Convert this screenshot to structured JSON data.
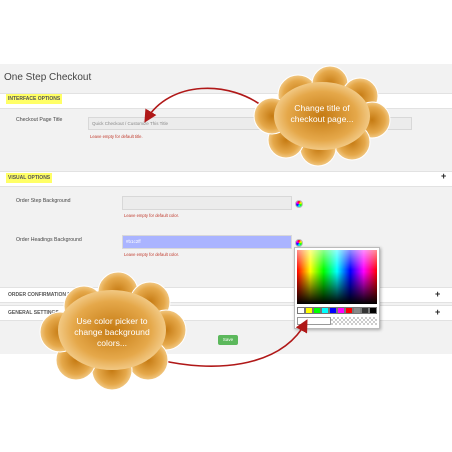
{
  "page": {
    "title": "One Step Checkout"
  },
  "sections": {
    "interface": {
      "title": "INTERFACE OPTIONS"
    },
    "visual": {
      "title": "VISUAL OPTIONS"
    },
    "order_confirmation": {
      "title": "ORDER CONFIRMATION PAGE"
    },
    "general": {
      "title": "GENERAL SETTINGS"
    }
  },
  "fields": {
    "checkout_title": {
      "label": "Checkout Page Title",
      "placeholder": "Quick Checkout / Customize This Title",
      "hint": "Leave empty for default title."
    },
    "order_step_bg": {
      "label": "Order Step Background",
      "value": "",
      "hint": "Leave empty for default color."
    },
    "order_headings_bg": {
      "label": "Order Headings Background",
      "value": "#b1c2ff",
      "hint": "Leave empty for default color."
    }
  },
  "buttons": {
    "save": "Save",
    "expand": "+"
  },
  "picker": {
    "swatches": [
      "#ffffff",
      "#ffff00",
      "#00ff00",
      "#00ffff",
      "#0000ff",
      "#ff00ff",
      "#ff0000",
      "#888888",
      "#333333",
      "#000000"
    ]
  },
  "callouts": {
    "title": "Change title of checkout page...",
    "title_lines": [
      "Change title of",
      "checkout page..."
    ],
    "color": "Use color picker to change background colors...",
    "color_lines": [
      "Use color picker to",
      "change background",
      "colors..."
    ]
  },
  "colors": {
    "cloud_fill": "#fbe0ad",
    "cloud_stroke": "#ffffff",
    "arrow": "#b01818",
    "highlight": "#ffff66",
    "save": "#5cb85c"
  }
}
